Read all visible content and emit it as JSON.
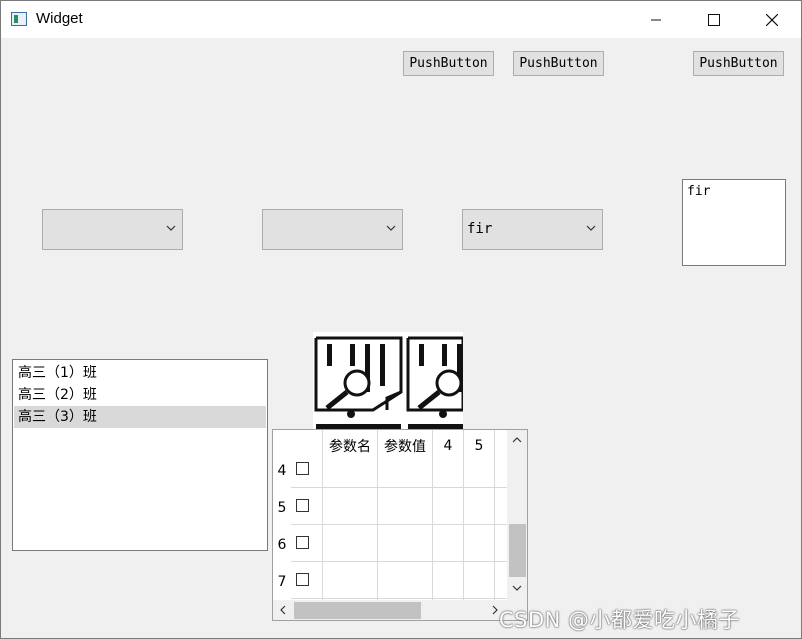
{
  "window": {
    "title": "Widget"
  },
  "buttons": [
    {
      "label": "PushButton"
    },
    {
      "label": "PushButton"
    },
    {
      "label": "PushButton"
    }
  ],
  "combos": [
    {
      "value": ""
    },
    {
      "value": ""
    },
    {
      "value": "fir"
    }
  ],
  "textbox": {
    "value": "fir"
  },
  "list": {
    "items": [
      "高三（1）班",
      "高三（2）班",
      "高三（3）班"
    ],
    "selected_index": 2
  },
  "table": {
    "columns": [
      "参数名",
      "参数值",
      "4",
      "5"
    ],
    "row_headers": [
      "4",
      "5",
      "6",
      "7"
    ]
  },
  "icons": [
    "chart-search-icon",
    "chart-search-icon"
  ],
  "watermark": "CSDN @小都爱吃小橘子"
}
